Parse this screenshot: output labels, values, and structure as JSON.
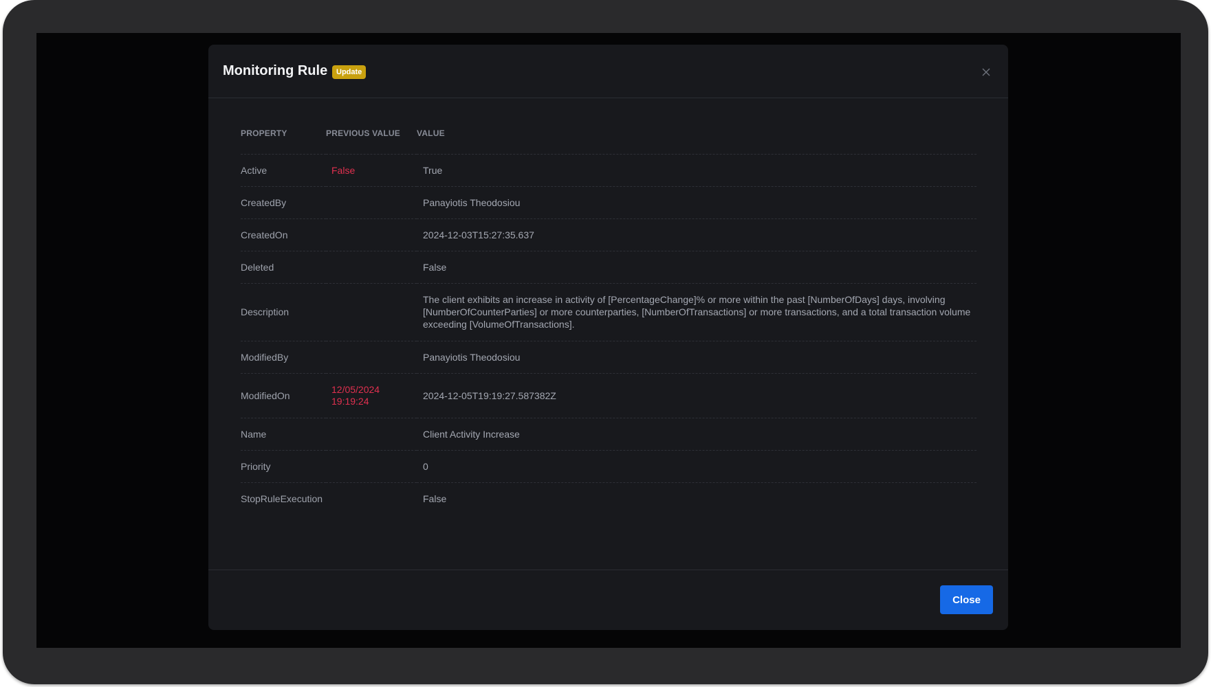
{
  "modal": {
    "title": "Monitoring Rule",
    "badge": "Update",
    "badge_color": "#c9a10f",
    "close_icon": "close-icon",
    "columns": [
      "PROPERTY",
      "PREVIOUS VALUE",
      "VALUE"
    ],
    "rows": [
      {
        "property": "Active",
        "previous": "False",
        "value": "True"
      },
      {
        "property": "CreatedBy",
        "previous": "",
        "value": "Panayiotis Theodosiou"
      },
      {
        "property": "CreatedOn",
        "previous": "",
        "value": "2024-12-03T15:27:35.637"
      },
      {
        "property": "Deleted",
        "previous": "",
        "value": "False"
      },
      {
        "property": "Description",
        "previous": "",
        "value": "The client exhibits an increase in activity of [PercentageChange]% or more within the past [NumberOfDays] days, involving [NumberOfCounterParties] or more counterparties, [NumberOfTransactions] or more transactions, and a total transaction volume exceeding [VolumeOfTransactions]."
      },
      {
        "property": "ModifiedBy",
        "previous": "",
        "value": "Panayiotis Theodosiou"
      },
      {
        "property": "ModifiedOn",
        "previous": "12/05/2024 19:19:24",
        "value": "2024-12-05T19:19:27.587382Z"
      },
      {
        "property": "Name",
        "previous": "",
        "value": "Client Activity Increase"
      },
      {
        "property": "Priority",
        "previous": "",
        "value": "0"
      },
      {
        "property": "StopRuleExecution",
        "previous": "",
        "value": "False"
      }
    ],
    "close_button_label": "Close",
    "accent_color": "#1669e6",
    "changed_value_color": "#e0304f"
  }
}
